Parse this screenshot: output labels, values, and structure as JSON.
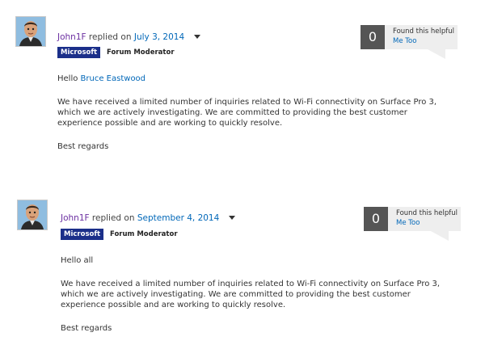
{
  "posts": [
    {
      "author": "John1F",
      "replied": "replied on",
      "date": "July 3, 2014",
      "badge": "Microsoft",
      "role": "Forum Moderator",
      "helpful_count": "0",
      "found_helpful": "Found this helpful",
      "me_too": "Me Too",
      "greeting": "Hello",
      "greeting_name": "Bruce  Eastwood",
      "paragraph": "We have received a limited number of inquiries related to Wi-Fi connectivity on Surface Pro 3, which we are actively investigating. We are committed to providing the best customer experience possible and are working to quickly resolve.",
      "signoff": "Best regards"
    },
    {
      "author": "John1F",
      "replied": "replied on",
      "date": "September 4, 2014",
      "badge": "Microsoft",
      "role": "Forum Moderator",
      "helpful_count": "0",
      "found_helpful": "Found this helpful",
      "me_too": "Me Too",
      "greeting": "Hello all",
      "paragraph": "We have received a limited number of inquiries related to Wi-Fi connectivity on Surface Pro 3, which we are actively investigating. We are committed to providing the best customer experience possible and are working to quickly resolve.",
      "signoff": "Best regards"
    }
  ]
}
